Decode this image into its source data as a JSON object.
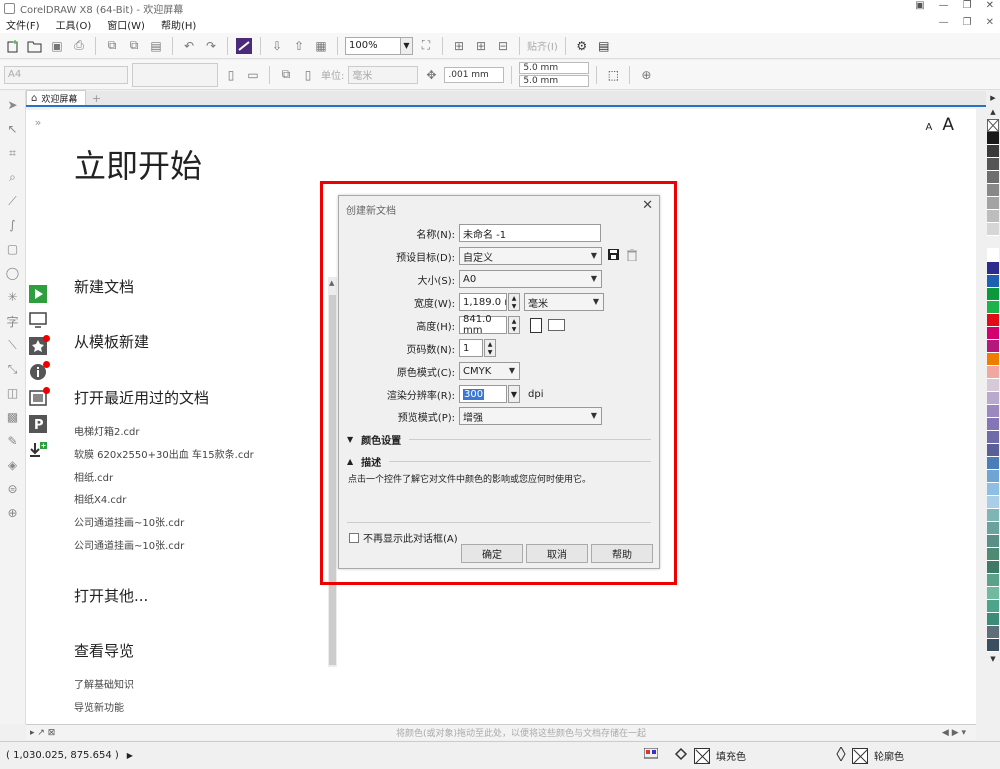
{
  "window": {
    "title": "CorelDRAW X8 (64-Bit) - 欢迎屏幕",
    "controls": [
      "▣",
      "—",
      "❐",
      "✕"
    ]
  },
  "menubar": {
    "items": [
      "文件(F)",
      "工具(O)",
      "窗口(W)",
      "帮助(H)"
    ],
    "mdi_controls": [
      "—",
      "❐",
      "✕"
    ]
  },
  "toolbar": {
    "zoom": "100%",
    "paste_label": "贴齐(I)"
  },
  "property_bar": {
    "page_size": "A4",
    "units_label": "单位:",
    "units_value": "毫米",
    "nudge": ".001 mm",
    "dup_x": "5.0 mm",
    "dup_y": "5.0 mm"
  },
  "tabs": {
    "welcome_tab": "欢迎屏幕",
    "add": "+"
  },
  "welcome": {
    "title": "立即开始",
    "font_small": "A",
    "font_large": "A",
    "new_doc": "新建文档",
    "from_template": "从模板新建",
    "open_recent": "打开最近用过的文档",
    "recent_files": [
      "电梯灯箱2.cdr",
      "软膜 620x2550+30出血 车15款条.cdr",
      "相纸.cdr",
      "相纸X4.cdr",
      "公司通道挂画~10张.cdr",
      "公司通道挂画~10张.cdr"
    ],
    "open_other": "打开其他...",
    "tour": "查看导览",
    "basics": "了解基础知识",
    "new_features": "导览新功能"
  },
  "dialog": {
    "title": "创建新文档",
    "name_label": "名称(N):",
    "name_value": "未命名 -1",
    "preset_label": "预设目标(D):",
    "preset_value": "自定义",
    "size_label": "大小(S):",
    "size_value": "A0",
    "width_label": "宽度(W):",
    "width_value": "1,189.0 mm",
    "width_unit": "毫米",
    "height_label": "高度(H):",
    "height_value": "841.0 mm",
    "pages_label": "页码数(N):",
    "pages_value": "1",
    "color_mode_label": "原色模式(C):",
    "color_mode_value": "CMYK",
    "resolution_label": "渲染分辨率(R):",
    "resolution_value": "300",
    "resolution_unit": "dpi",
    "preview_label": "预览模式(P):",
    "preview_value": "增强",
    "color_settings": "颜色设置",
    "description_section": "描述",
    "description_text": "点击一个控件了解它对文件中颜色的影响或您应何时使用它。",
    "dont_show": "不再显示此对话框(A)",
    "ok": "确定",
    "cancel": "取消",
    "help": "帮助"
  },
  "bottombar": {
    "hint": "将颜色(或对象)拖动至此处，以便将这些颜色与文档存储在一起"
  },
  "status": {
    "coords": "( 1,030.025, 875.654 )",
    "fill_label": "填充色",
    "outline_label": "轮廓色"
  },
  "palette_colors": [
    "#1a1a1a",
    "#3a3a3a",
    "#555555",
    "#6e6e6e",
    "#888888",
    "#a3a3a3",
    "#bdbdbd",
    "#d6d6d6",
    "#f0f0f0",
    "#ffffff",
    "#2c2c8f",
    "#1e5fb4",
    "#0a9a3c",
    "#1bb34a",
    "#e30b17",
    "#d4006f",
    "#b5177d",
    "#ee7d00",
    "#f3a7a1",
    "#d8c9d9",
    "#b8a9cf",
    "#9c88c0",
    "#8476b6",
    "#6f6aa8",
    "#5b5f99",
    "#4a7eb8",
    "#6fa4d4",
    "#8ebee3",
    "#a9cfe8",
    "#7fb5b5",
    "#6aa39e",
    "#5a8f87",
    "#4e8a74",
    "#3f7a66",
    "#5aa38a",
    "#6fbaa1",
    "#4ea48a",
    "#3c8c7a",
    "#5f6f7a",
    "#3a5060"
  ]
}
